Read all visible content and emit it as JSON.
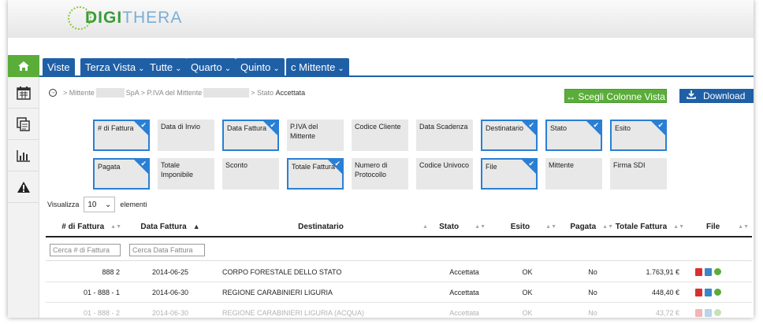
{
  "brand": {
    "logo_text_a": "DIGI",
    "logo_text_b": "THERA"
  },
  "nav": {
    "tabs": [
      {
        "label": "Viste",
        "caret": ""
      },
      {
        "label": "Terza Vista",
        "caret": "⌄"
      },
      {
        "label": "Tutte",
        "caret": "⌄"
      },
      {
        "label": "Quarto",
        "caret": "⌄"
      },
      {
        "label": "Quinto",
        "caret": "⌄"
      },
      {
        "label": "c Mittente",
        "caret": "⌄"
      }
    ]
  },
  "sidebar": {
    "icons": [
      "home-icon",
      "calendar-icon",
      "copy-icon",
      "bar-chart-icon",
      "warning-icon"
    ]
  },
  "breadcrumb": {
    "arrow": "→",
    "part1": "> Mittente",
    "part2": "SpA > P.IVA del Mittente",
    "part3": "> Stato",
    "current": "Accettata"
  },
  "actions": {
    "choose_columns": "↔ Scegli Colonne Vista",
    "download": "Download"
  },
  "column_chips": [
    {
      "label": "# di Fattura",
      "selected": true
    },
    {
      "label": "Data di Invio",
      "selected": false
    },
    {
      "label": "Data Fattura",
      "selected": true
    },
    {
      "label": "P.IVA del Mittente",
      "selected": false
    },
    {
      "label": "Codice Cliente",
      "selected": false
    },
    {
      "label": "Data Scadenza",
      "selected": false
    },
    {
      "label": "Destinatario",
      "selected": true
    },
    {
      "label": "Stato",
      "selected": true
    },
    {
      "label": "Esito",
      "selected": true
    },
    {
      "label": "Pagata",
      "selected": true
    },
    {
      "label": "Totale Imponibile",
      "selected": false
    },
    {
      "label": "Sconto",
      "selected": false
    },
    {
      "label": "Totale Fattura",
      "selected": true
    },
    {
      "label": "Numero di Protocollo",
      "selected": false
    },
    {
      "label": "Codice Univoco",
      "selected": false
    },
    {
      "label": "File",
      "selected": true
    },
    {
      "label": "Mittente",
      "selected": false
    },
    {
      "label": "Firma SDI",
      "selected": false
    }
  ],
  "page_size": {
    "label_before": "Visualizza",
    "value": "10",
    "label_after": "elementi"
  },
  "table": {
    "headers": [
      "# di Fattura",
      "Data Fattura",
      "Destinatario",
      "Stato",
      "Esito",
      "Pagata",
      "Totale Fattura",
      "File"
    ],
    "filters": {
      "numero_placeholder": "Cerca # di Fattura",
      "data_placeholder": "Cerca Data Fattura"
    },
    "rows": [
      {
        "numero": "888 2",
        "data": "2014-06-25",
        "destinatario": "CORPO FORESTALE DELLO STATO",
        "stato": "Accettata",
        "esito": "OK",
        "pagata": "No",
        "totale": "1.763,91 €"
      },
      {
        "numero": "01 - 888 - 1",
        "data": "2014-06-30",
        "destinatario": "REGIONE CARABINIERI LIGURIA",
        "stato": "Accettata",
        "esito": "OK",
        "pagata": "No",
        "totale": "448,40 €"
      },
      {
        "numero": "01 - 888 - 2",
        "data": "2014-06-30",
        "destinatario": "REGIONE CARABINIERI LIGURIA (ACQUA)",
        "stato": "Accettata",
        "esito": "OK",
        "pagata": "No",
        "totale": "43,72 €"
      }
    ]
  },
  "colors": {
    "nav_blue": "#1f5fa6",
    "accent_green": "#5aad39",
    "chip_border": "#2a7fd4"
  }
}
